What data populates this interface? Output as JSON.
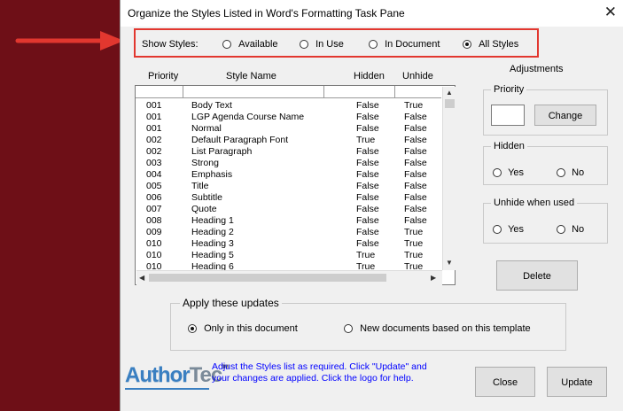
{
  "window": {
    "title": "Organize the Styles Listed in Word's Formatting Task Pane",
    "close_glyph": "✕"
  },
  "show_styles": {
    "label": "Show Styles:",
    "options": [
      "Available",
      "In Use",
      "In Document",
      "All Styles"
    ],
    "selected": "All Styles"
  },
  "table": {
    "headers": [
      "Priority",
      "Style Name",
      "Hidden",
      "Unhide"
    ],
    "rows": [
      [
        "001",
        "Body Text",
        "False",
        "True"
      ],
      [
        "001",
        "LGP Agenda Course Name",
        "False",
        "False"
      ],
      [
        "001",
        "Normal",
        "False",
        "False"
      ],
      [
        "002",
        "Default Paragraph Font",
        "True",
        "False"
      ],
      [
        "002",
        "List Paragraph",
        "False",
        "False"
      ],
      [
        "003",
        "Strong",
        "False",
        "False"
      ],
      [
        "004",
        "Emphasis",
        "False",
        "False"
      ],
      [
        "005",
        "Title",
        "False",
        "False"
      ],
      [
        "006",
        "Subtitle",
        "False",
        "False"
      ],
      [
        "007",
        "Quote",
        "False",
        "False"
      ],
      [
        "008",
        "Heading 1",
        "False",
        "False"
      ],
      [
        "009",
        "Heading 2",
        "False",
        "True"
      ],
      [
        "010",
        "Heading 3",
        "False",
        "True"
      ],
      [
        "010",
        "Heading 5",
        "True",
        "True"
      ],
      [
        "010",
        "Heading 6",
        "True",
        "True"
      ]
    ]
  },
  "adjustments": {
    "title": "Adjustments",
    "priority": {
      "legend": "Priority",
      "value": "",
      "button": "Change"
    },
    "hidden": {
      "legend": "Hidden",
      "yes": "Yes",
      "no": "No"
    },
    "unhide": {
      "legend": "Unhide when used",
      "yes": "Yes",
      "no": "No"
    },
    "delete_button": "Delete"
  },
  "apply": {
    "legend": "Apply these updates",
    "options": [
      "Only in this document",
      "New documents based on this template"
    ],
    "selected": "Only in this document"
  },
  "footer": {
    "logo_text_1": "Author",
    "logo_text_2": "Tec",
    "logo_tm": "TM",
    "help_line1": "Adjust the Styles list as required. Click \"Update\" and",
    "help_line2": "your changes are applied. Click the logo for help.",
    "close_button": "Close",
    "update_button": "Update"
  },
  "colors": {
    "dialog_bg": "#f0f0f0",
    "window_backdrop": "#6e0f17",
    "highlight": "#e2372f",
    "help_text": "#0000ff",
    "logo_blue": "#3a7fc1"
  }
}
